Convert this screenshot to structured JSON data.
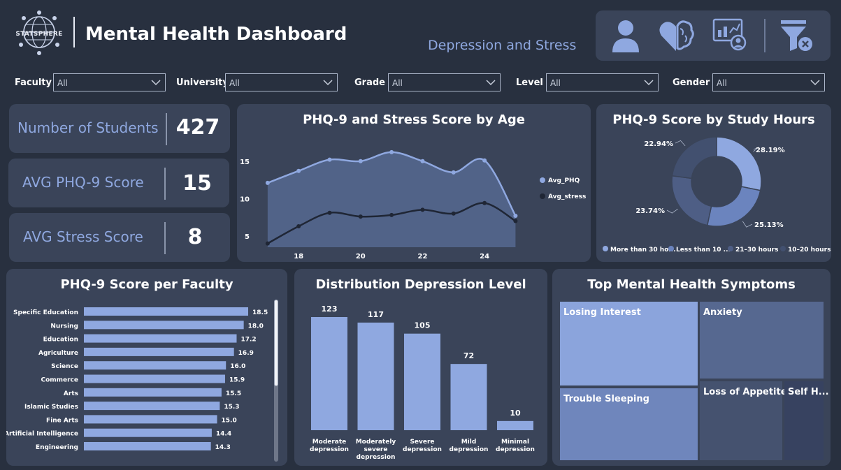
{
  "header": {
    "logo_text": "STATSPHERE",
    "title": "Mental Health Dashboard",
    "subtitle": "Depression and Stress",
    "nav_icons": [
      "user-icon",
      "brain-heart-icon",
      "analytics-icon",
      "clear-filter-icon"
    ]
  },
  "filters": [
    {
      "label": "Faculty",
      "value": "All"
    },
    {
      "label": "University",
      "value": "All"
    },
    {
      "label": "Grade",
      "value": "All"
    },
    {
      "label": "Level",
      "value": "All"
    },
    {
      "label": "Gender",
      "value": "All"
    }
  ],
  "kpis": [
    {
      "label": "Number of Students",
      "value": "427"
    },
    {
      "label": "AVG PHQ-9 Score",
      "value": "15"
    },
    {
      "label": "AVG Stress Score",
      "value": "8"
    }
  ],
  "colors": {
    "background": "#28303f",
    "card": "#3a4459",
    "accent": "#8fa8e0",
    "dark_series": "#1f2635"
  },
  "chart_data": [
    {
      "id": "age",
      "type": "area",
      "title": "PHQ-9 and Stress Score by Age",
      "x": [
        17,
        18,
        19,
        20,
        21,
        22,
        23,
        24,
        25
      ],
      "xticks": [
        18,
        20,
        22,
        24
      ],
      "yticks": [
        5,
        10,
        15
      ],
      "ylim": [
        3.5,
        17.5
      ],
      "xlim": [
        16.8,
        25.6
      ],
      "series": [
        {
          "name": "Avg_PHQ",
          "values": [
            12.1,
            13.7,
            15.2,
            15.0,
            16.2,
            15.0,
            13.5,
            15.1,
            7.7
          ],
          "color": "#8fa8e0"
        },
        {
          "name": "Avg_stress",
          "values": [
            4.0,
            6.3,
            8.1,
            7.6,
            7.8,
            8.5,
            8.0,
            9.4,
            7.0
          ],
          "color": "#1f2635"
        }
      ],
      "legend": "right"
    },
    {
      "id": "study_hours",
      "type": "pie",
      "title": "PHQ-9 Score by Study Hours",
      "slices": [
        {
          "name": "More than 30 ho...",
          "value": 28.19,
          "label": "28.19%",
          "color": "#8fa8e0"
        },
        {
          "name": "Less than 10 ...",
          "value": 25.13,
          "label": "25.13%",
          "color": "#6b84be"
        },
        {
          "name": "21–30 hours",
          "value": 23.74,
          "label": "23.74%",
          "color": "#4e5e85"
        },
        {
          "name": "10–20 hours",
          "value": 22.94,
          "label": "22.94%",
          "color": "#42506f"
        }
      ],
      "legend": "bottom"
    },
    {
      "id": "faculty",
      "type": "bar",
      "orientation": "horizontal",
      "title": "PHQ-9 Score per Faculty",
      "categories": [
        "Specific Education",
        "Nursing",
        "Education",
        "Agriculture",
        "Science",
        "Commerce",
        "Arts",
        "Islamic Studies",
        "Fine Arts",
        "Artificial Intelligence",
        "Engineering"
      ],
      "values": [
        18.5,
        18.0,
        17.2,
        16.9,
        16.0,
        15.9,
        15.5,
        15.3,
        15.0,
        14.4,
        14.3
      ],
      "labels": [
        "18.5",
        "18.0",
        "17.2",
        "16.9",
        "16.0",
        "15.9",
        "15.5",
        "15.3",
        "15.0",
        "14.4",
        "14.3"
      ],
      "xlim": [
        0,
        18.5
      ]
    },
    {
      "id": "depression",
      "type": "bar",
      "title": "Distribution Depression Level",
      "categories": [
        "Moderate depression",
        "Moderately severe depression",
        "Severe depression",
        "Mild depression",
        "Minimal depression"
      ],
      "category_lines": [
        [
          "Moderate",
          "depression"
        ],
        [
          "Moderately",
          "severe",
          "depression"
        ],
        [
          "Severe",
          "depression"
        ],
        [
          "Mild",
          "depression"
        ],
        [
          "Minimal",
          "depression"
        ]
      ],
      "values": [
        123,
        117,
        105,
        72,
        10
      ],
      "ylim": [
        0,
        123
      ]
    }
  ],
  "symptoms": {
    "title": "Top Mental Health Symptoms",
    "items": [
      {
        "name": "Losing Interest",
        "color": "#8ba4dc"
      },
      {
        "name": "Anxiety",
        "color": "#566890"
      },
      {
        "name": "Trouble Sleeping",
        "color": "#6f86bc"
      },
      {
        "name": "Loss of Appetite",
        "color": "#45526f"
      },
      {
        "name": "Self H...",
        "color": "#374260"
      }
    ]
  }
}
